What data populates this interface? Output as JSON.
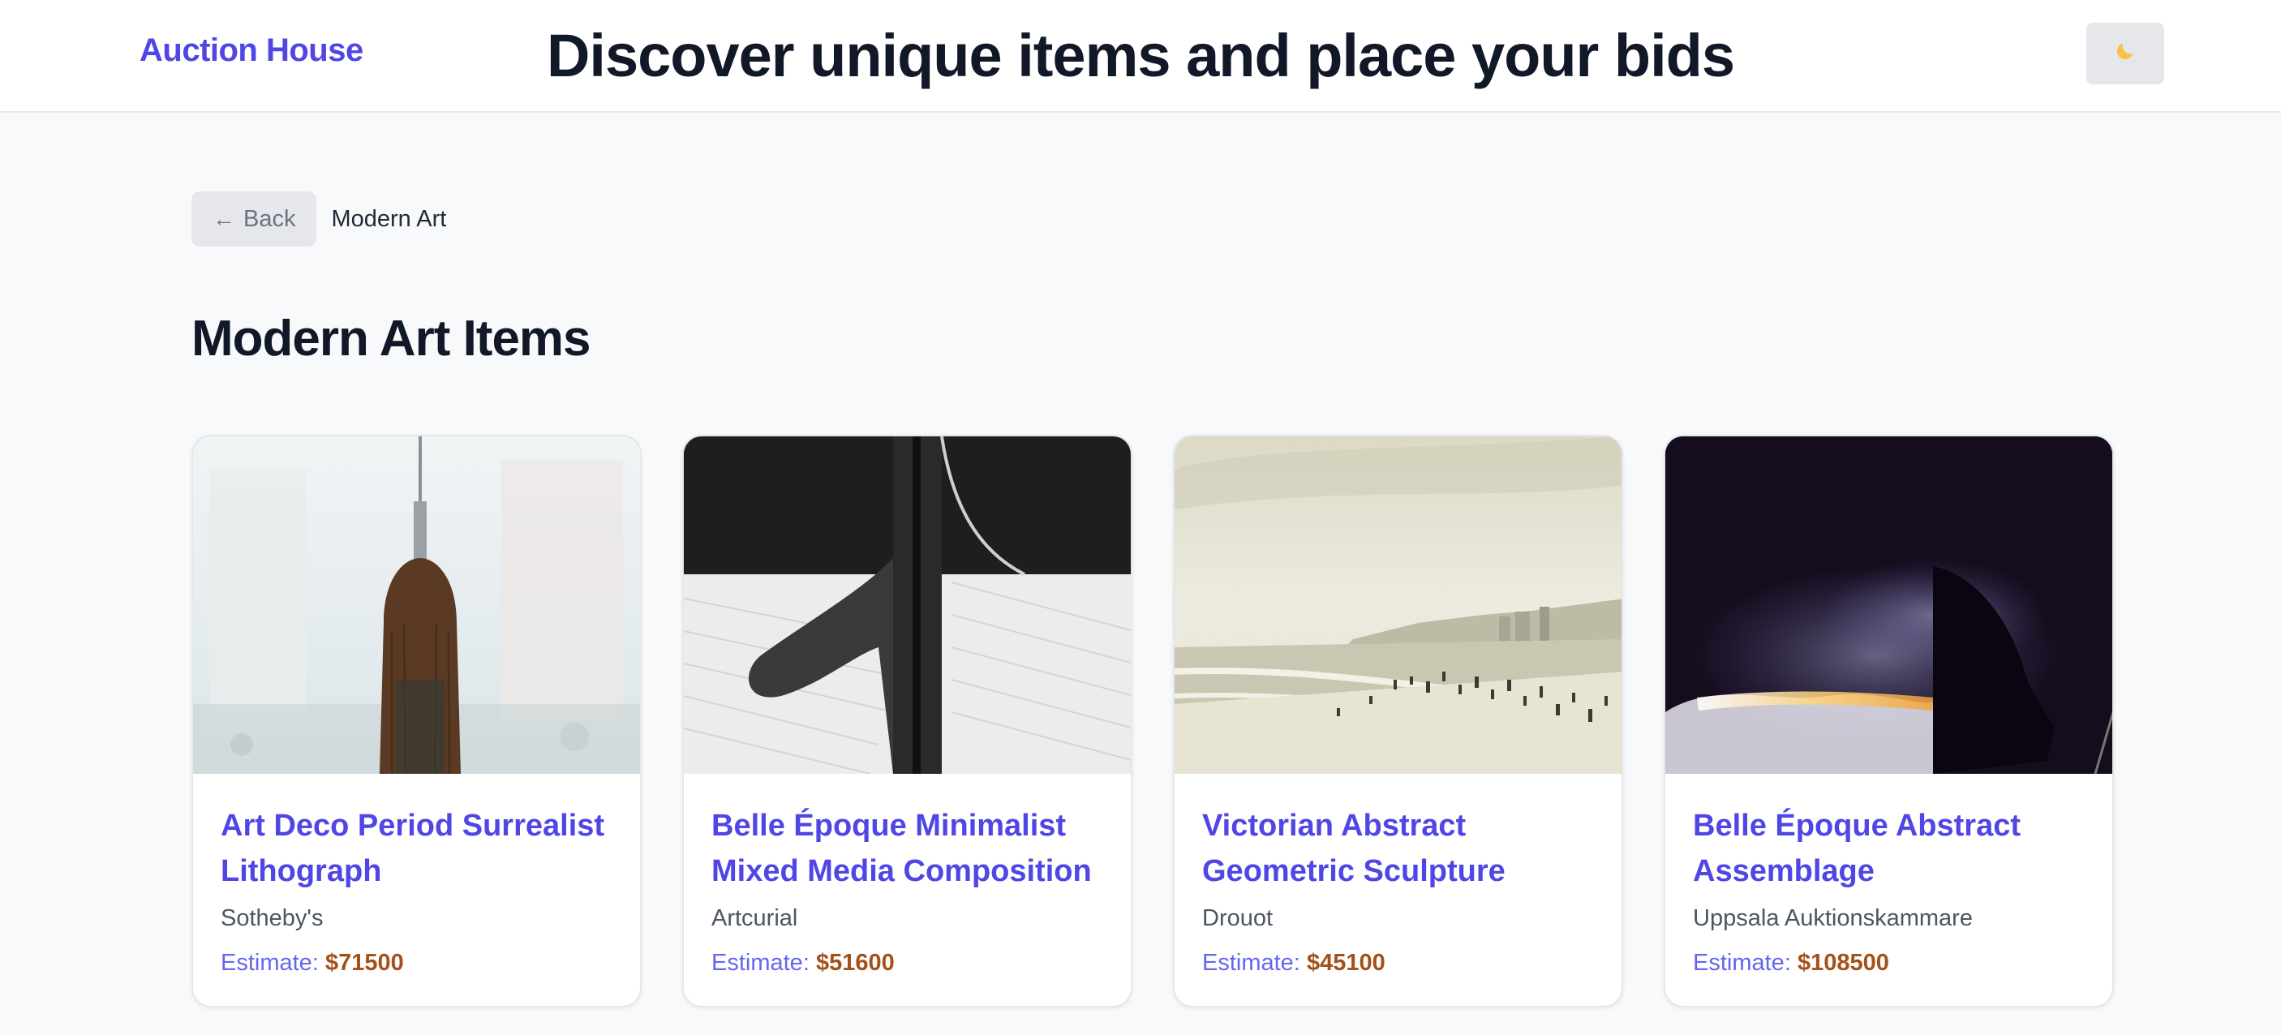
{
  "header": {
    "brand": "Auction House",
    "headline": "Discover unique items and place your bids",
    "theme_toggle_icon": "moon-icon"
  },
  "breadcrumb": {
    "back_label": "Back",
    "current": "Modern Art"
  },
  "section_title": "Modern Art Items",
  "estimate_label": "Estimate:",
  "colors": {
    "brand": "#4f46e5",
    "estimate_value": "#a3511a",
    "estimate_label": "#6366f1"
  },
  "items": [
    {
      "title": "Art Deco Period Surrealist Lithograph",
      "house": "Sotheby's",
      "estimate": "$71500"
    },
    {
      "title": "Belle Époque Minimalist Mixed Media Composition",
      "house": "Artcurial",
      "estimate": "$51600"
    },
    {
      "title": "Victorian Abstract Geometric Sculpture",
      "house": "Drouot",
      "estimate": "$45100"
    },
    {
      "title": "Belle Époque Abstract Assemblage",
      "house": "Uppsala Auktionskammare",
      "estimate": "$108500"
    }
  ]
}
